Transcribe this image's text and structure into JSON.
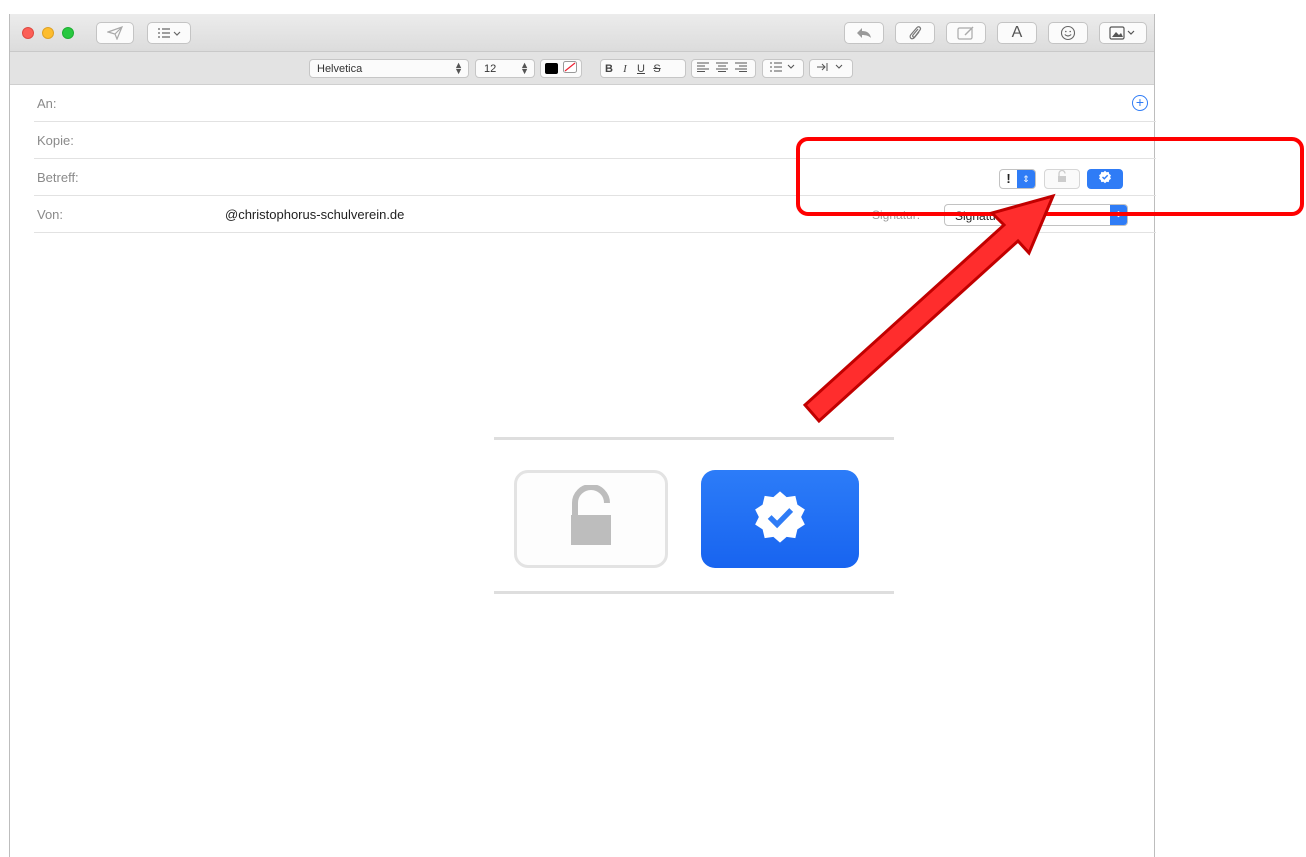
{
  "toolbar": {
    "send_icon": "paper-plane-icon",
    "header_fields_icon": "list-dropdown-icon",
    "reply_icon": "reply-arrow-icon",
    "attach_icon": "paperclip-icon",
    "markup_icon": "markup-icon",
    "fonts_label": "A",
    "emoji_icon": "smiley-icon",
    "photo_icon": "photo-browser-icon"
  },
  "format": {
    "font_name": "Helvetica",
    "font_size": "12",
    "text_color": "#000000",
    "bold": "B",
    "italic": "I",
    "underline": "U",
    "strike": "S"
  },
  "headers": {
    "to_label": "An:",
    "cc_label": "Kopie:",
    "subject_label": "Betreff:",
    "from_label": "Von:",
    "from_value": "@christophorus-schulverein.de",
    "priority_mark": "!",
    "signature_label": "Signatur:",
    "signature_value": "Signatur 1"
  },
  "colors": {
    "accent": "#2f7cf6",
    "annotation": "#ff0000"
  }
}
